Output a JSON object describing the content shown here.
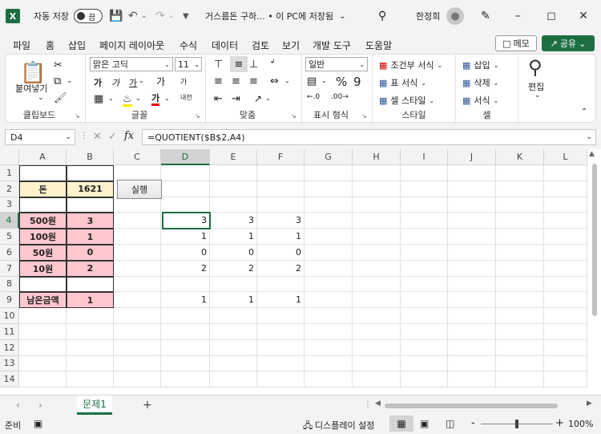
{
  "titlebar": {
    "logo": "X",
    "autosave_label": "자동 저장",
    "autosave_state": "끔",
    "doc_title": "거스름돈 구하... • 이 PC에 저장됨",
    "user_name": "한정희",
    "icons": [
      "save-icon",
      "undo-icon",
      "redo-icon",
      "customize-icon",
      "search-icon",
      "avatar",
      "pen-icon",
      "minimize-icon",
      "maximize-icon",
      "close-icon"
    ]
  },
  "menu": {
    "items": [
      "파일",
      "홈",
      "삽입",
      "페이지 레이아웃",
      "수식",
      "데이터",
      "검토",
      "보기",
      "개발 도구",
      "도움말"
    ],
    "active": "홈",
    "memo_label": "메모",
    "share_label": "공유"
  },
  "ribbon": {
    "clipboard": {
      "paste": "붙여넣기",
      "label": "클립보드"
    },
    "font": {
      "font_name": "맑은 고딕",
      "font_size": "11",
      "label": "글꼴",
      "grow": "가",
      "shrink": "가",
      "bold": "가",
      "italic": "가",
      "underline": "가",
      "font_color": "가",
      "phonetic": "내천"
    },
    "alignment": {
      "label": "맞춤"
    },
    "number": {
      "format": "일반",
      "label": "표시 형식"
    },
    "styles": {
      "conditional": "조건부 서식",
      "table": "표 서식",
      "cell": "셀 스타일",
      "label": "스타일"
    },
    "cells": {
      "insert": "삽입",
      "delete": "삭제",
      "format": "서식",
      "label": "셀"
    },
    "editing": {
      "label": "편집"
    }
  },
  "formula_bar": {
    "name_box": "D4",
    "formula": "=QUOTIENT($B$2,A4)"
  },
  "sheet": {
    "columns": [
      "A",
      "B",
      "C",
      "D",
      "E",
      "F",
      "G",
      "H",
      "I",
      "J",
      "K",
      "L"
    ],
    "rows": [
      "1",
      "2",
      "3",
      "4",
      "5",
      "6",
      "7",
      "8",
      "9",
      "10",
      "11",
      "12",
      "13",
      "14"
    ],
    "run_button": "실행",
    "cells": {
      "A2": "돈",
      "B2": "1621",
      "A4": "500원",
      "B4": "3",
      "A5": "100원",
      "B5": "1",
      "A6": "50원",
      "B6": "0",
      "A7": "10원",
      "B7": "2",
      "A9": "남은금액",
      "B9": "1",
      "D4": "3",
      "E4": "3",
      "F4": "3",
      "D5": "1",
      "E5": "1",
      "F5": "1",
      "D6": "0",
      "E6": "0",
      "F6": "0",
      "D7": "2",
      "E7": "2",
      "F7": "2",
      "D9": "1",
      "E9": "1",
      "F9": "1"
    },
    "colors": {
      "label_fill": "#fff2cc",
      "value_fill": "#ffc7ce",
      "selection": "#1d6f42"
    }
  },
  "tabs": {
    "sheets": [
      "문제1"
    ],
    "add": "+"
  },
  "status": {
    "ready": "준비",
    "display_settings": "디스플레이 설정",
    "zoom": "100%",
    "zoom_minus": "-",
    "zoom_plus": "+"
  }
}
